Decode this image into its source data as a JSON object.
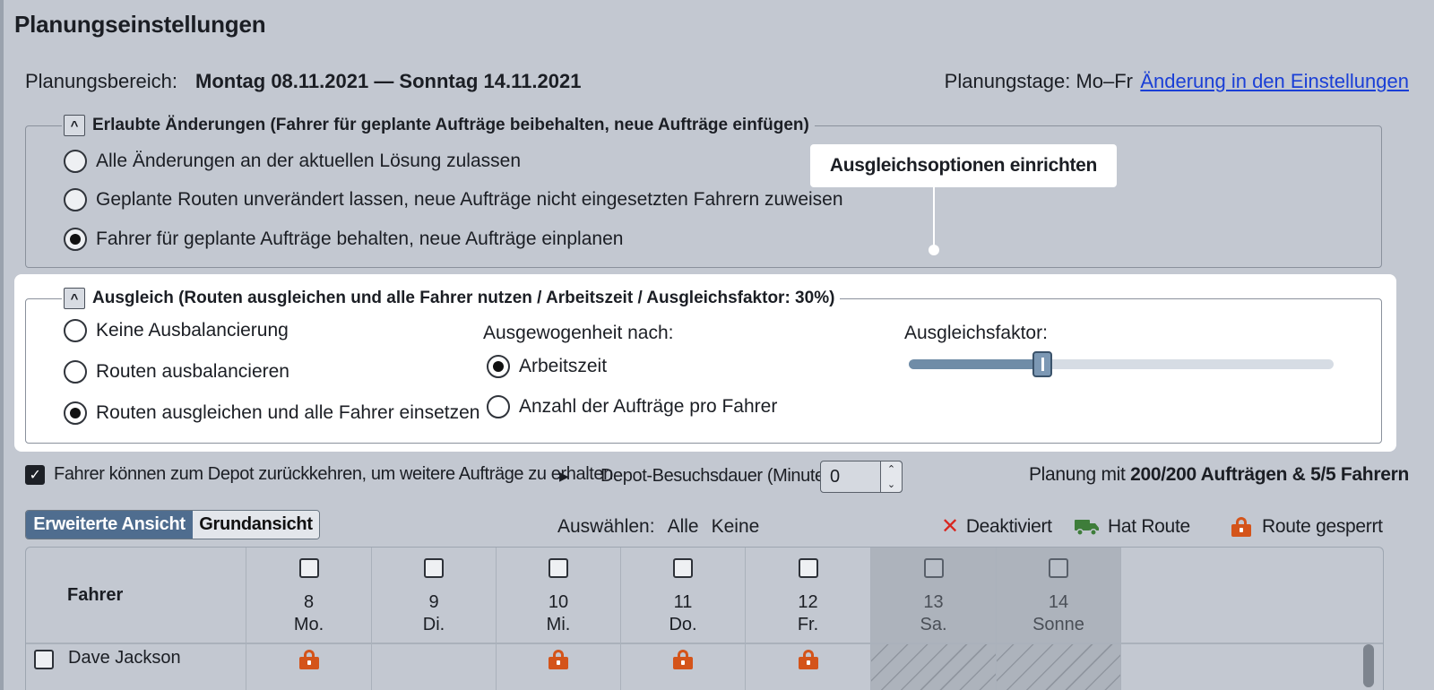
{
  "page": {
    "title": "Planungseinstellungen"
  },
  "range": {
    "label": "Planungsbereich:",
    "value": "Montag 08.11.2021 — Sonntag 14.11.2021",
    "days_label": "Planungstage: Mo–Fr",
    "settings_link": "Änderung in den Einstellungen"
  },
  "allowed_changes": {
    "collapse_glyph": "^",
    "legend": "Erlaubte Änderungen (Fahrer für geplante Aufträge beibehalten, neue Aufträge einfügen)",
    "options": [
      {
        "label": "Alle Änderungen an der aktuellen Lösung zulassen",
        "selected": false
      },
      {
        "label": "Geplante Routen unverändert lassen, neue Aufträge nicht eingesetzten Fahrern zuweisen",
        "selected": false
      },
      {
        "label": "Fahrer für geplante Aufträge behalten, neue Aufträge einplanen",
        "selected": true
      }
    ]
  },
  "tooltip": {
    "text": "Ausgleichsoptionen einrichten"
  },
  "balance": {
    "collapse_glyph": "^",
    "legend": "Ausgleich (Routen ausgleichen und alle Fahrer nutzen / Arbeitszeit / Ausgleichsfaktor: 30%)",
    "options": [
      {
        "label": "Keine Ausbalancierung",
        "selected": false
      },
      {
        "label": "Routen ausbalancieren",
        "selected": false
      },
      {
        "label": "Routen ausgleichen und alle Fahrer einsetzen",
        "selected": true
      }
    ],
    "by_label": "Ausgewogenheit nach:",
    "by_options": [
      {
        "label": "Arbeitszeit",
        "selected": true
      },
      {
        "label": "Anzahl der Aufträge pro Fahrer",
        "selected": false
      }
    ],
    "factor_label": "Ausgleichsfaktor:",
    "factor_value": 0.3
  },
  "depot": {
    "checked": true,
    "check_glyph": "✓",
    "return_label": "Fahrer können zum Depot zurückkehren, um weitere Aufträge zu erhalten",
    "expand_glyph": "▶",
    "duration_label": "Depot-Besuchsdauer (Minuten):",
    "duration_value": "0",
    "stepper_up": "⌃",
    "stepper_down": "⌄"
  },
  "summary": {
    "prefix": "Planung mit ",
    "bold": "200/200 Aufträgen & 5/5 Fahrern"
  },
  "view": {
    "active": "Erweiterte Ansicht",
    "inactive": "Grundansicht"
  },
  "select": {
    "label": "Auswählen:",
    "all": "Alle",
    "none": "Keine"
  },
  "keys": {
    "deactivated_glyph": "✕",
    "deactivated": "Deaktiviert",
    "has_route": "Hat Route",
    "locked": "Route gesperrt"
  },
  "colors": {
    "lock": "#d4541a",
    "truck": "#3e7d3a",
    "deactivated": "#d8261f",
    "accent": "#4f6d8f",
    "link": "#1a3fd6"
  },
  "icons": [
    "collapse-icon",
    "x-icon",
    "truck-icon",
    "lock-icon",
    "chevron-right-icon"
  ],
  "table": {
    "driver_header": "Fahrer",
    "days": [
      {
        "num": "8",
        "name": "Mo."
      },
      {
        "num": "9",
        "name": "Di."
      },
      {
        "num": "10",
        "name": "Mi."
      },
      {
        "num": "11",
        "name": "Do."
      },
      {
        "num": "12",
        "name": "Fr."
      },
      {
        "num": "13",
        "name": "Sa."
      },
      {
        "num": "14",
        "name": "Sonne"
      }
    ],
    "rows": [
      {
        "driver": "Dave Jackson",
        "locked_days": [
          "8",
          "10",
          "11",
          "12"
        ]
      }
    ]
  }
}
